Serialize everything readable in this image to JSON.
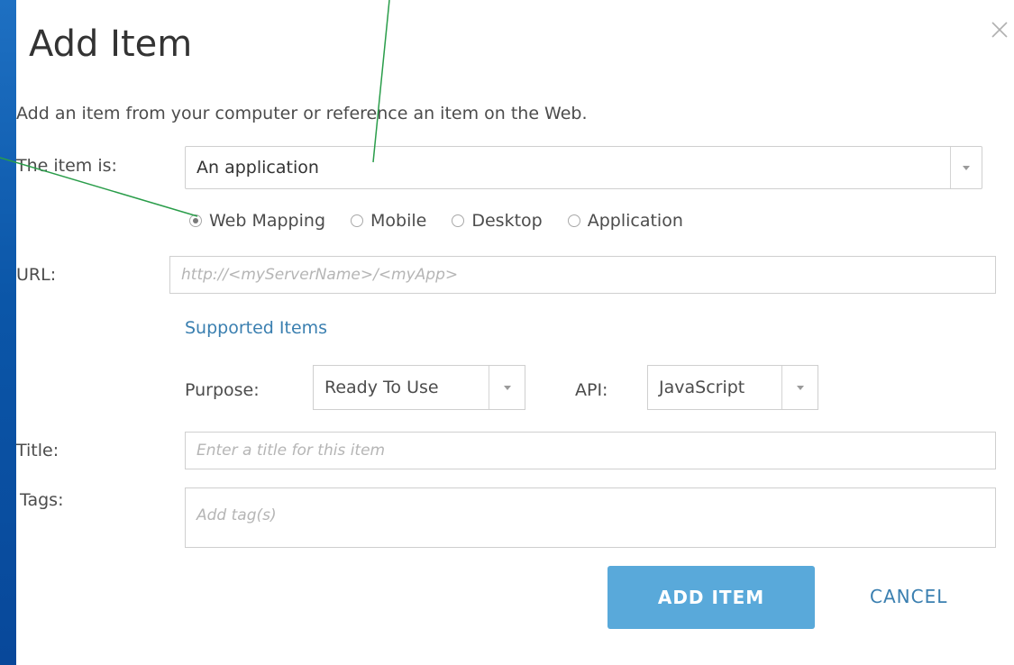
{
  "dialog": {
    "title": "Add Item",
    "close_label": "×",
    "intro": "Add an item from your computer or reference an item on the Web."
  },
  "type_field": {
    "label": "The item is:",
    "value": "An application"
  },
  "radio_options": [
    "Web Mapping",
    "Mobile",
    "Desktop",
    "Application"
  ],
  "radio_selected": "Web Mapping",
  "url_field": {
    "label": "URL:",
    "placeholder": "http://<myServerName>/<myApp>"
  },
  "supported_items_link": "Supported Items",
  "purpose": {
    "label": "Purpose:",
    "value": "Ready To Use"
  },
  "api": {
    "label": "API:",
    "value": "JavaScript"
  },
  "title_field": {
    "label": "Title:",
    "placeholder": "Enter a title for this item"
  },
  "tags_field": {
    "label": "Tags:",
    "placeholder": "Add tag(s)"
  },
  "buttons": {
    "add_item": "ADD ITEM",
    "cancel": "CANCEL"
  },
  "colors": {
    "background": "#0b56a8",
    "primary_button": "#59a9da",
    "link": "#3a7fb0",
    "callout_line": "#2a9d4a"
  }
}
